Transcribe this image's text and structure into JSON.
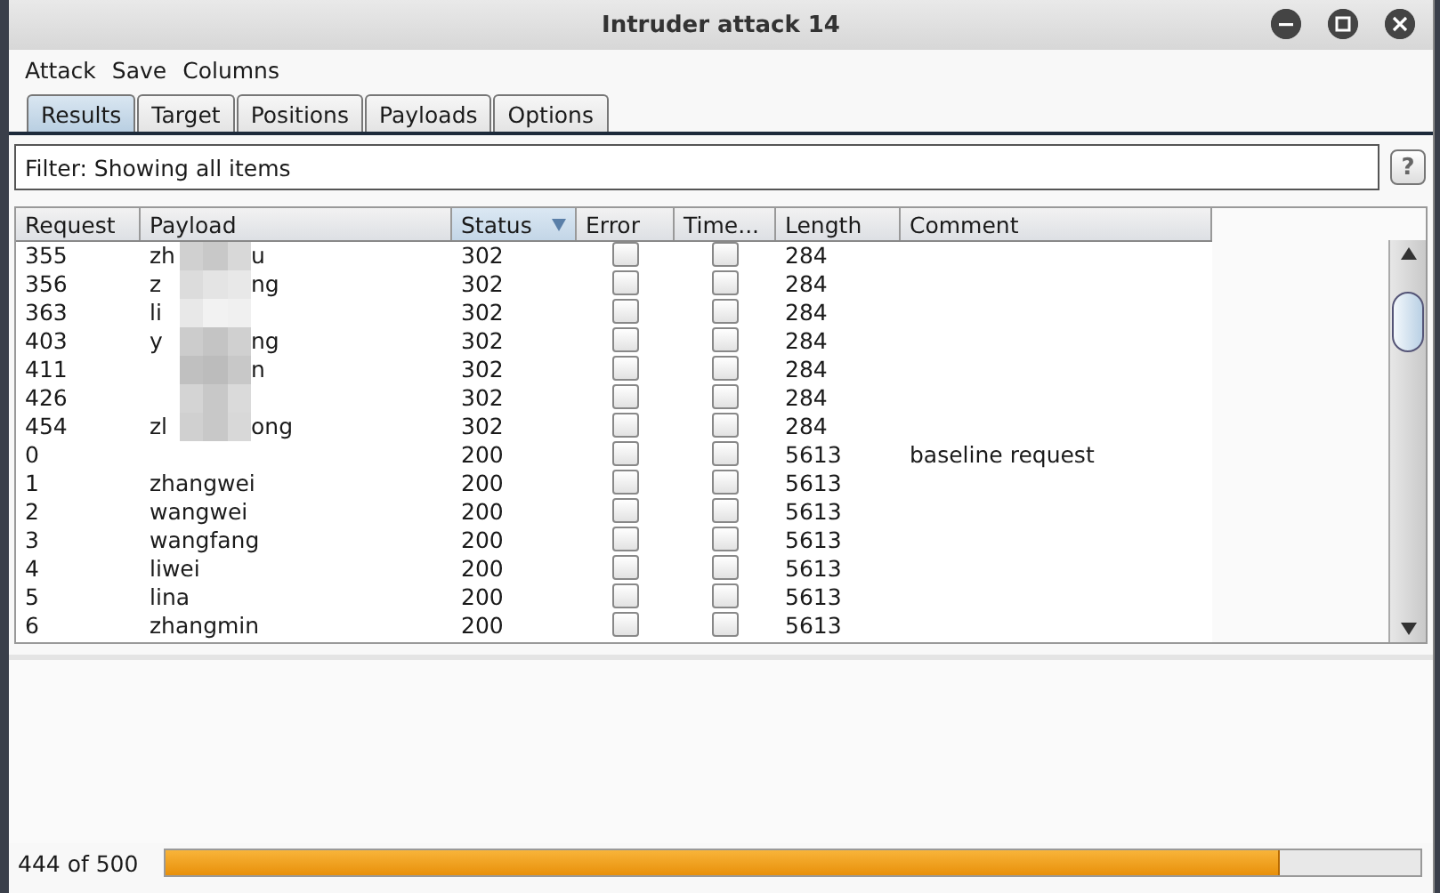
{
  "window": {
    "title": "Intruder attack 14"
  },
  "menu": [
    "Attack",
    "Save",
    "Columns"
  ],
  "tabs": [
    {
      "label": "Results",
      "selected": true
    },
    {
      "label": "Target",
      "selected": false
    },
    {
      "label": "Positions",
      "selected": false
    },
    {
      "label": "Payloads",
      "selected": false
    },
    {
      "label": "Options",
      "selected": false
    }
  ],
  "filter": {
    "text": "Filter: Showing all items",
    "help": "?"
  },
  "table": {
    "columns": [
      {
        "label": "Request",
        "sorted": false
      },
      {
        "label": "Payload",
        "sorted": false
      },
      {
        "label": "Status",
        "sorted": true
      },
      {
        "label": "Error",
        "sorted": false
      },
      {
        "label": "Time...",
        "sorted": false
      },
      {
        "label": "Length",
        "sorted": false
      },
      {
        "label": "Comment",
        "sorted": false
      }
    ],
    "rows": [
      {
        "request": "355",
        "payload": "zh",
        "payload_end": "u",
        "redacted": true,
        "status": "302",
        "error": false,
        "timeout": false,
        "length": "284"
      },
      {
        "request": "356",
        "payload": "z",
        "payload_end": "ng",
        "redacted": true,
        "status": "302",
        "error": false,
        "timeout": false,
        "length": "284"
      },
      {
        "request": "363",
        "payload": "li",
        "redacted": true,
        "status": "302",
        "error": false,
        "timeout": false,
        "length": "284"
      },
      {
        "request": "403",
        "payload": "y",
        "payload_end": "ng",
        "redacted": true,
        "status": "302",
        "error": false,
        "timeout": false,
        "length": "284"
      },
      {
        "request": "411",
        "payload_end": "n",
        "redacted": true,
        "status": "302",
        "error": false,
        "timeout": false,
        "length": "284"
      },
      {
        "request": "426",
        "redacted": true,
        "status": "302",
        "error": false,
        "timeout": false,
        "length": "284"
      },
      {
        "request": "454",
        "payload": "zl",
        "payload_end": "ong",
        "redacted": true,
        "status": "302",
        "error": false,
        "timeout": false,
        "length": "284"
      },
      {
        "request": "0",
        "status": "200",
        "error": false,
        "timeout": false,
        "length": "5613",
        "comment": "baseline request"
      },
      {
        "request": "1",
        "payload": "zhangwei",
        "status": "200",
        "error": false,
        "timeout": false,
        "length": "5613"
      },
      {
        "request": "2",
        "payload": "wangwei",
        "status": "200",
        "error": false,
        "timeout": false,
        "length": "5613"
      },
      {
        "request": "3",
        "payload": "wangfang",
        "status": "200",
        "error": false,
        "timeout": false,
        "length": "5613"
      },
      {
        "request": "4",
        "payload": "liwei",
        "status": "200",
        "error": false,
        "timeout": false,
        "length": "5613"
      },
      {
        "request": "5",
        "payload": "lina",
        "status": "200",
        "error": false,
        "timeout": false,
        "length": "5613"
      },
      {
        "request": "6",
        "payload": "zhangmin",
        "status": "200",
        "error": false,
        "timeout": false,
        "length": "5613"
      }
    ]
  },
  "status_bar": {
    "progress_text": "444 of 500",
    "level": 0.888
  }
}
